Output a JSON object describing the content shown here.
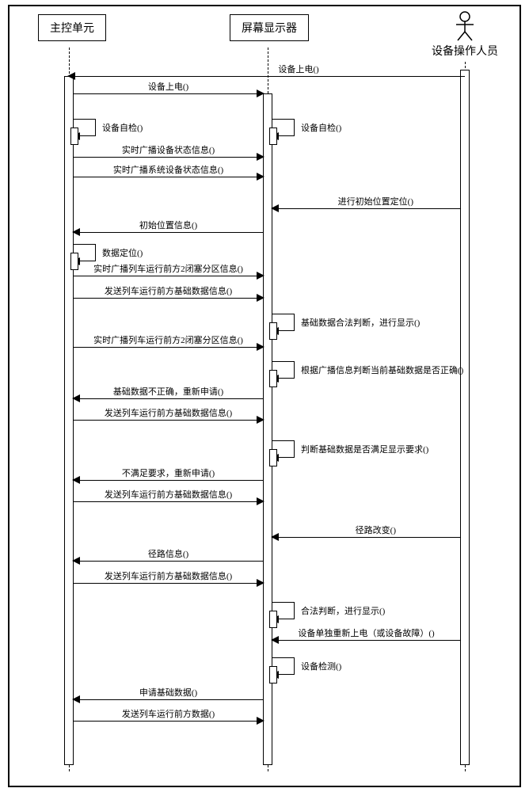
{
  "participants": {
    "main_unit": "主控单元",
    "display": "屏幕显示器",
    "operator": "设备操作人员"
  },
  "messages": {
    "m1": "设备上电()",
    "m2": "设备上电()",
    "s1": "设备自检()",
    "s2": "设备自检()",
    "m3": "实时广播设备状态信息()",
    "m4": "实时广播系统设备状态信息()",
    "m5": "进行初始位置定位()",
    "m6": "初始位置信息()",
    "s3": "数据定位()",
    "m7": "实时广播列车运行前方2闭塞分区信息()",
    "m8": "发送列车运行前方基础数据信息()",
    "s4": "基础数据合法判断，进行显示()",
    "m9": "实时广播列车运行前方2闭塞分区信息()",
    "s5": "根据广播信息判断当前基础数据是否正确()",
    "m10": "基础数据不正确，重新申请()",
    "m11": "发送列车运行前方基础数据信息()",
    "s6": "判断基础数据是否满足显示要求()",
    "m12": "不满足要求，重新申请()",
    "m13": "发送列车运行前方基础数据信息()",
    "m14": "径路改变()",
    "m15": "径路信息()",
    "m16": "发送列车运行前方基础数据信息()",
    "s7": "合法判断，进行显示()",
    "m17": "设备单独重新上电（或设备故障）()",
    "s8": "设备检测()",
    "m18": "申请基础数据()",
    "m19": "发送列车运行前方数据()"
  },
  "chart_data": {
    "type": "sequence-diagram",
    "participants": [
      "主控单元",
      "屏幕显示器",
      "设备操作人员"
    ],
    "interactions": [
      {
        "from": "设备操作人员",
        "to": "主控单元",
        "label": "设备上电()"
      },
      {
        "from": "主控单元",
        "to": "屏幕显示器",
        "label": "设备上电()"
      },
      {
        "from": "主控单元",
        "to": "主控单元",
        "label": "设备自检()"
      },
      {
        "from": "屏幕显示器",
        "to": "屏幕显示器",
        "label": "设备自检()"
      },
      {
        "from": "主控单元",
        "to": "屏幕显示器",
        "label": "实时广播设备状态信息()"
      },
      {
        "from": "主控单元",
        "to": "屏幕显示器",
        "label": "实时广播系统设备状态信息()"
      },
      {
        "from": "设备操作人员",
        "to": "屏幕显示器",
        "label": "进行初始位置定位()"
      },
      {
        "from": "屏幕显示器",
        "to": "主控单元",
        "label": "初始位置信息()"
      },
      {
        "from": "主控单元",
        "to": "主控单元",
        "label": "数据定位()"
      },
      {
        "from": "主控单元",
        "to": "屏幕显示器",
        "label": "实时广播列车运行前方2闭塞分区信息()"
      },
      {
        "from": "主控单元",
        "to": "屏幕显示器",
        "label": "发送列车运行前方基础数据信息()"
      },
      {
        "from": "屏幕显示器",
        "to": "屏幕显示器",
        "label": "基础数据合法判断，进行显示()"
      },
      {
        "from": "主控单元",
        "to": "屏幕显示器",
        "label": "实时广播列车运行前方2闭塞分区信息()"
      },
      {
        "from": "屏幕显示器",
        "to": "屏幕显示器",
        "label": "根据广播信息判断当前基础数据是否正确()"
      },
      {
        "from": "屏幕显示器",
        "to": "主控单元",
        "label": "基础数据不正确，重新申请()"
      },
      {
        "from": "主控单元",
        "to": "屏幕显示器",
        "label": "发送列车运行前方基础数据信息()"
      },
      {
        "from": "屏幕显示器",
        "to": "屏幕显示器",
        "label": "判断基础数据是否满足显示要求()"
      },
      {
        "from": "屏幕显示器",
        "to": "主控单元",
        "label": "不满足要求，重新申请()"
      },
      {
        "from": "主控单元",
        "to": "屏幕显示器",
        "label": "发送列车运行前方基础数据信息()"
      },
      {
        "from": "设备操作人员",
        "to": "屏幕显示器",
        "label": "径路改变()"
      },
      {
        "from": "屏幕显示器",
        "to": "主控单元",
        "label": "径路信息()"
      },
      {
        "from": "主控单元",
        "to": "屏幕显示器",
        "label": "发送列车运行前方基础数据信息()"
      },
      {
        "from": "屏幕显示器",
        "to": "屏幕显示器",
        "label": "合法判断，进行显示()"
      },
      {
        "from": "设备操作人员",
        "to": "屏幕显示器",
        "label": "设备单独重新上电（或设备故障）()"
      },
      {
        "from": "屏幕显示器",
        "to": "屏幕显示器",
        "label": "设备检测()"
      },
      {
        "from": "屏幕显示器",
        "to": "主控单元",
        "label": "申请基础数据()"
      },
      {
        "from": "主控单元",
        "to": "屏幕显示器",
        "label": "发送列车运行前方数据()"
      }
    ]
  }
}
